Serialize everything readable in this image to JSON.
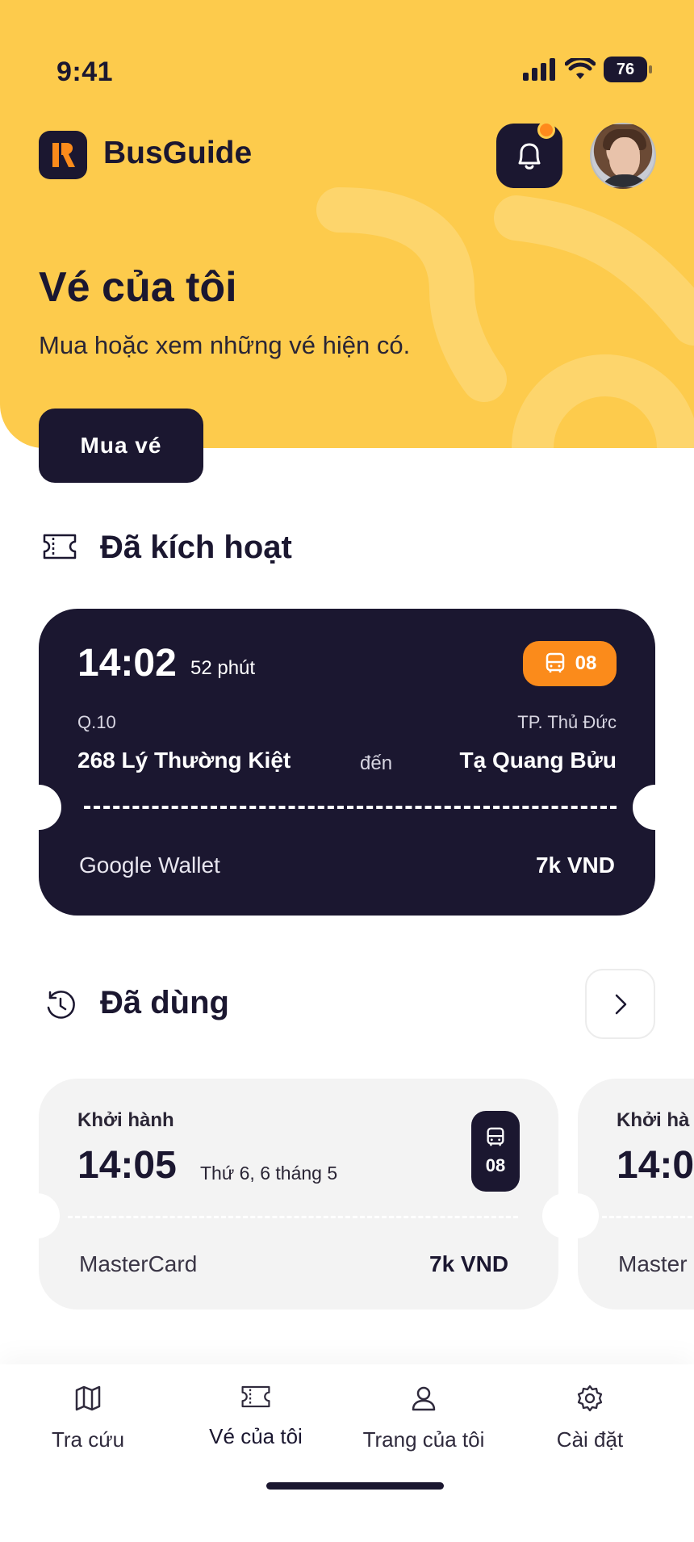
{
  "status_bar": {
    "time": "9:41",
    "battery": "76"
  },
  "header": {
    "brand": "BusGuide",
    "title": "Vé của tôi",
    "subtitle": "Mua hoặc xem những vé hiện có."
  },
  "actions": {
    "buy_label": "Mua vé"
  },
  "sections": {
    "active_title": "Đã kích hoạt",
    "used_title": "Đã dùng"
  },
  "active_ticket": {
    "time": "14:02",
    "duration": "52 phút",
    "route": "08",
    "from_area": "Q.10",
    "from_stop": "268 Lý Thường Kiệt",
    "connector": "đến",
    "to_area": "TP. Thủ Đức",
    "to_stop": "Tạ Quang Bửu",
    "payment": "Google Wallet",
    "price": "7k VND"
  },
  "used_tickets": [
    {
      "label": "Khởi hành",
      "time": "14:05",
      "date": "Thứ 6, 6 tháng 5",
      "route": "08",
      "payment": "MasterCard",
      "price": "7k VND"
    },
    {
      "label": "Khởi hà",
      "time": "14:0",
      "payment": "Master"
    }
  ],
  "nav": {
    "items": [
      {
        "label": "Tra cứu",
        "icon": "map-icon"
      },
      {
        "label": "Vé của tôi",
        "icon": "ticket-icon"
      },
      {
        "label": "Trang của tôi",
        "icon": "user-icon"
      },
      {
        "label": "Cài đặt",
        "icon": "gear-icon"
      }
    ],
    "active": "Vé của tôi"
  },
  "colors": {
    "accent_yellow": "#fdcb4c",
    "dark": "#1b1730",
    "orange": "#fb8b1b",
    "card_gray": "#f3f3f3"
  }
}
